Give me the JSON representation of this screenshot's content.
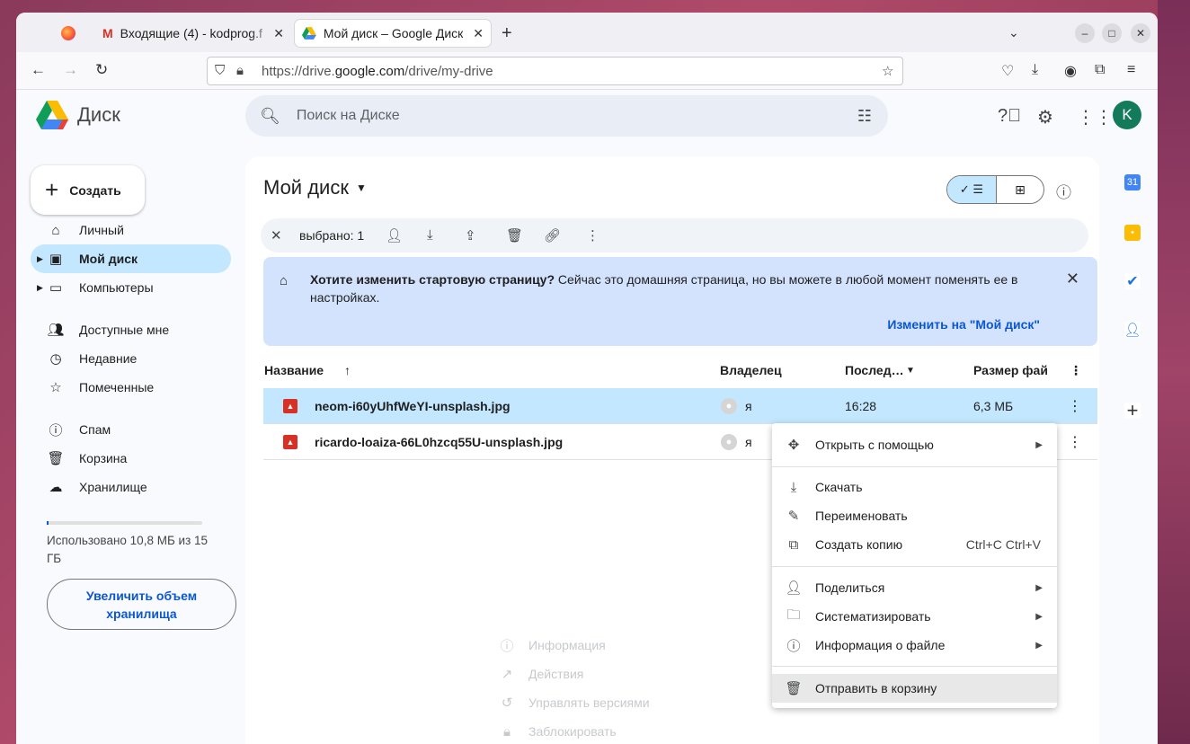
{
  "browser": {
    "tabs": [
      {
        "label": "Входящие (4) - kodprog.f"
      },
      {
        "label": "Мой диск – Google Диск"
      }
    ],
    "url_prefix": "https://drive.",
    "url_domain": "google.com",
    "url_path": "/drive/my-drive"
  },
  "app": {
    "logo_text": "Диск",
    "search_placeholder": "Поиск на Диске",
    "avatar_letter": "K",
    "create_label": "Создать"
  },
  "sidebar": {
    "items": [
      {
        "label": "Личный",
        "icon": "home-icon"
      },
      {
        "label": "Мой диск",
        "icon": "drive-icon"
      },
      {
        "label": "Компьютеры",
        "icon": "computer-icon"
      },
      {
        "label": "Доступные мне",
        "icon": "shared-icon"
      },
      {
        "label": "Недавние",
        "icon": "clock-icon"
      },
      {
        "label": "Помеченные",
        "icon": "star-icon"
      },
      {
        "label": "Спам",
        "icon": "spam-icon"
      },
      {
        "label": "Корзина",
        "icon": "trash-icon"
      },
      {
        "label": "Хранилище",
        "icon": "cloud-icon"
      }
    ],
    "storage_text": "Использовано 10,8 МБ из 15 ГБ",
    "storage_fraction": 0.0007,
    "upgrade_label": "Увеличить объем хранилища"
  },
  "main": {
    "title": "Мой диск",
    "selection": "выбрано: 1",
    "banner": {
      "bold": "Хотите изменить стартовую страницу?",
      "text": " Сейчас это домашняя страница, но вы можете в любой момент поменять ее в настройках.",
      "action": "Изменить на \"Мой диск\""
    },
    "columns": {
      "name": "Название",
      "owner": "Владелец",
      "modified": "Послед…",
      "size": "Размер фай"
    },
    "files": [
      {
        "name": "neom-i60yUhfWeYI-unsplash.jpg",
        "owner": "я",
        "date": "16:28",
        "size": "6,3 МБ"
      },
      {
        "name": "ricardo-loaiza-66L0hzcq55U-unsplash.jpg",
        "owner": "я",
        "date": "",
        "size": ""
      }
    ]
  },
  "context_menu": {
    "open_with": "Открыть с помощью",
    "download": "Скачать",
    "rename": "Переименовать",
    "copy": "Создать копию",
    "copy_shortcut": "Ctrl+C Ctrl+V",
    "share": "Поделиться",
    "organize": "Систематизировать",
    "file_info": "Информация о файле",
    "trash": "Отправить в корзину"
  },
  "submenu": {
    "info": "Информация",
    "activity": "Действия",
    "versions": "Управлять версиями",
    "lock": "Заблокировать"
  },
  "colors": {
    "accent": "#0b57d0",
    "selected": "#c2e7ff",
    "banner": "#d3e3fd"
  }
}
